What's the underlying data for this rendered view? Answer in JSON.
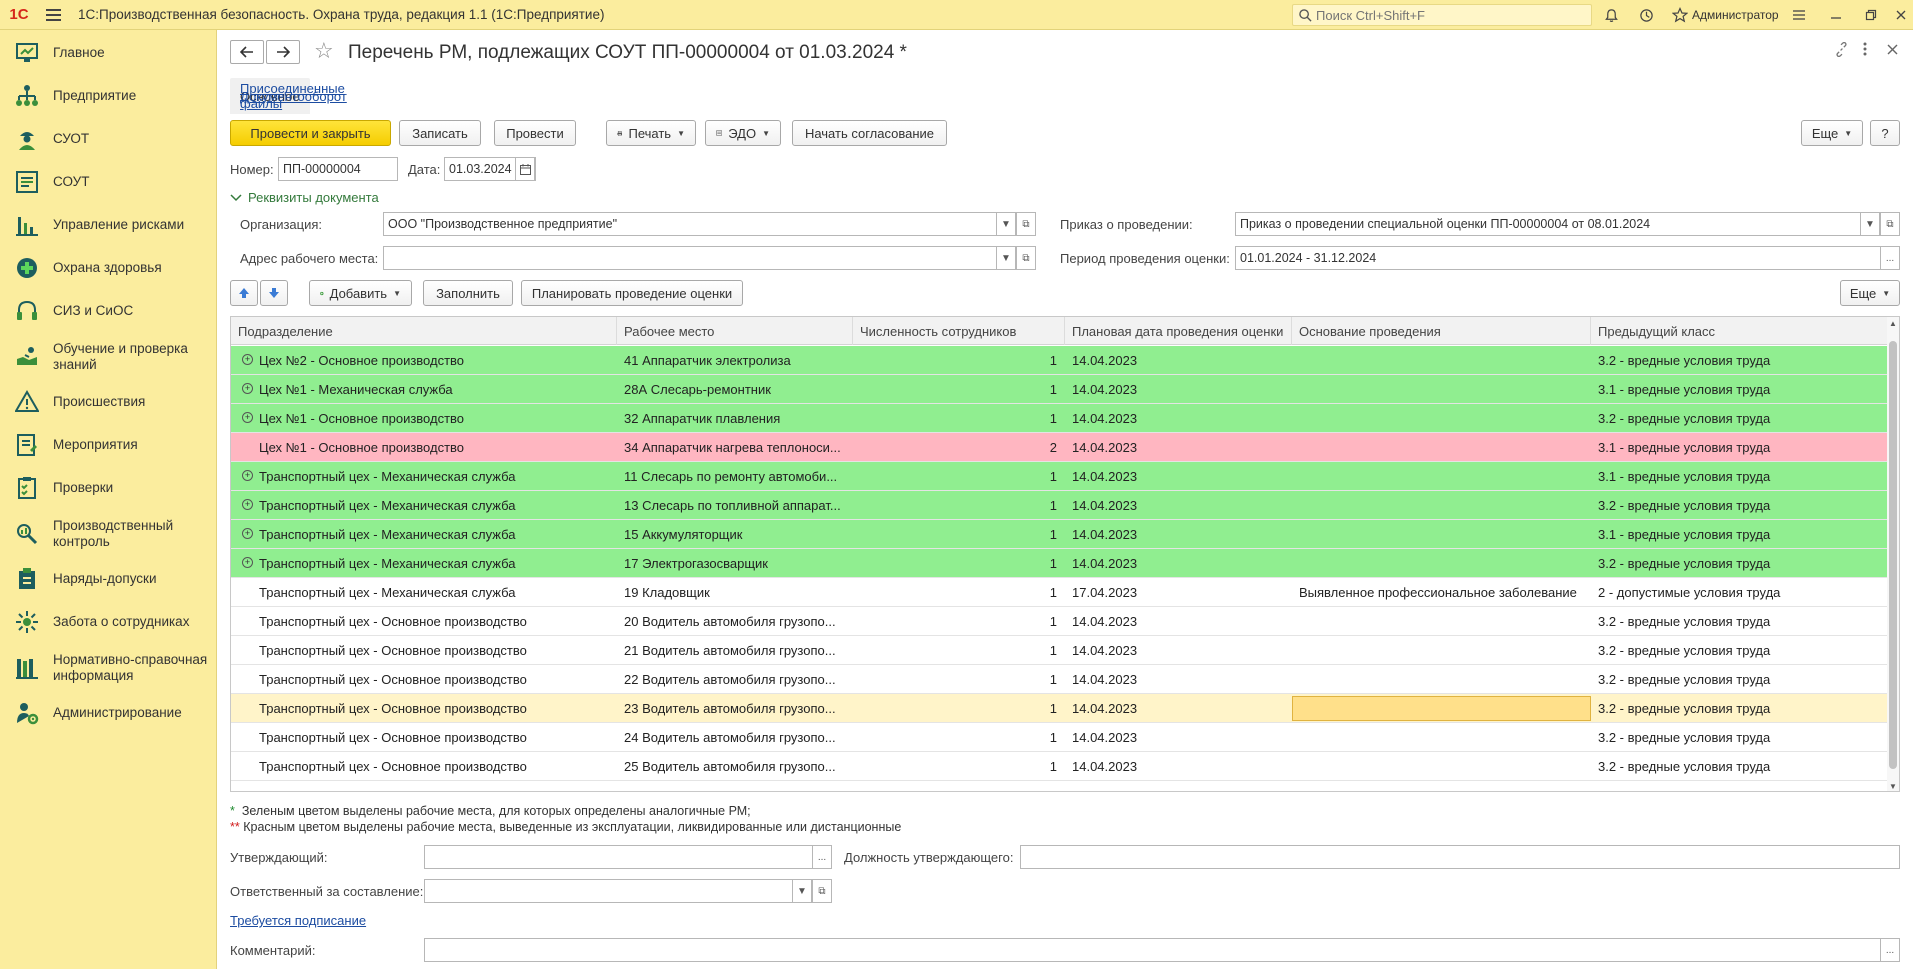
{
  "app": {
    "logo": "1С",
    "title": "1С:Производственная безопасность. Охрана труда, редакция 1.1  (1С:Предприятие)",
    "search_placeholder": "Поиск Ctrl+Shift+F",
    "user": "Администратор"
  },
  "sidebar": {
    "items": [
      {
        "label": "Главное",
        "icon": "desktop-icon"
      },
      {
        "label": "Предприятие",
        "icon": "org-structure-icon"
      },
      {
        "label": "СУОТ",
        "icon": "worker-icon"
      },
      {
        "label": "СОУТ",
        "icon": "list-icon"
      },
      {
        "label": "Управление рисками",
        "icon": "chart-icon"
      },
      {
        "label": "Охрана здоровья",
        "icon": "medical-cross-icon"
      },
      {
        "label": "СИЗ и СиОС",
        "icon": "headphones-icon"
      },
      {
        "label": "Обучение и проверка знаний",
        "icon": "training-icon"
      },
      {
        "label": "Происшествия",
        "icon": "warning-icon"
      },
      {
        "label": "Мероприятия",
        "icon": "tasks-icon"
      },
      {
        "label": "Проверки",
        "icon": "checklist-icon"
      },
      {
        "label": "Производственный контроль",
        "icon": "inspection-icon"
      },
      {
        "label": "Наряды-допуски",
        "icon": "permit-icon"
      },
      {
        "label": "Забота о сотрудниках",
        "icon": "care-icon"
      },
      {
        "label": "Нормативно-справочная информация",
        "icon": "reference-icon"
      },
      {
        "label": "Администрирование",
        "icon": "admin-icon"
      }
    ]
  },
  "document": {
    "title": "Перечень РМ, подлежащих СОУТ ПП-00000004 от 01.03.2024 *",
    "tabs": [
      "Основное",
      "Присоединенные файлы",
      "Документооборот"
    ],
    "toolbar": {
      "post_close": "Провести и закрыть",
      "save": "Записать",
      "post": "Провести",
      "print": "Печать",
      "edo": "ЭДО",
      "approval": "Начать согласование",
      "more": "Еще",
      "help": "?"
    },
    "number_label": "Номер:",
    "number_value": "ПП-00000004",
    "date_label": "Дата:",
    "date_value": "01.03.2024",
    "details_toggle": "Реквизиты документа",
    "org_label": "Организация:",
    "org_value": "ООО \"Производственное предприятие\"",
    "address_label": "Адрес рабочего места:",
    "address_value": "",
    "order_label": "Приказ о проведении:",
    "order_value": "Приказ о проведении специальной оценки ПП-00000004 от 08.01.2024",
    "period_label": "Период проведения оценки:",
    "period_value": "01.01.2024 - 31.12.2024"
  },
  "table_toolbar": {
    "add": "Добавить",
    "fill": "Заполнить",
    "plan": "Планировать проведение оценки",
    "more": "Еще"
  },
  "table": {
    "headers": [
      "Подразделение",
      "Рабочее место",
      "Численность сотрудников",
      "Плановая дата проведения оценки",
      "Основание проведения",
      "Предыдущий класс"
    ],
    "rows": [
      {
        "dept": "Цех №2 - Основное производство",
        "place": "41 Аппаратчик электролиза",
        "count": "1",
        "date": "14.04.2023",
        "basis": "",
        "cls": "3.2 - вредные условия труда",
        "status": "green",
        "expand": true
      },
      {
        "dept": "Цех №1 - Механическая служба",
        "place": "28А Слесарь-ремонтник",
        "count": "1",
        "date": "14.04.2023",
        "basis": "",
        "cls": "3.1 - вредные условия труда",
        "status": "green",
        "expand": true
      },
      {
        "dept": "Цех №1 - Основное производство",
        "place": "32 Аппаратчик плавления",
        "count": "1",
        "date": "14.04.2023",
        "basis": "",
        "cls": "3.2 - вредные условия труда",
        "status": "green",
        "expand": true
      },
      {
        "dept": "Цех №1 - Основное производство",
        "place": "34 Аппаратчик нагрева теплоноси...",
        "count": "2",
        "date": "14.04.2023",
        "basis": "",
        "cls": "3.1 - вредные условия труда",
        "status": "red",
        "expand": false
      },
      {
        "dept": "Транспортный цех - Механическая служба",
        "place": "11 Слесарь по ремонту автомоби...",
        "count": "1",
        "date": "14.04.2023",
        "basis": "",
        "cls": "3.1 - вредные условия труда",
        "status": "green",
        "expand": true
      },
      {
        "dept": "Транспортный цех - Механическая служба",
        "place": "13 Слесарь по топливной аппарат...",
        "count": "1",
        "date": "14.04.2023",
        "basis": "",
        "cls": "3.2 - вредные условия труда",
        "status": "green",
        "expand": true
      },
      {
        "dept": "Транспортный цех - Механическая служба",
        "place": "15 Аккумуляторщик",
        "count": "1",
        "date": "14.04.2023",
        "basis": "",
        "cls": "3.1 - вредные условия труда",
        "status": "green",
        "expand": true
      },
      {
        "dept": "Транспортный цех - Механическая служба",
        "place": "17 Электрогазосварщик",
        "count": "1",
        "date": "14.04.2023",
        "basis": "",
        "cls": "3.2 - вредные условия труда",
        "status": "green",
        "expand": true
      },
      {
        "dept": "Транспортный цех - Механическая служба",
        "place": "19 Кладовщик",
        "count": "1",
        "date": "17.04.2023",
        "basis": "Выявленное профессиональное заболевание",
        "cls": "2 - допустимые условия труда",
        "status": "white",
        "expand": false
      },
      {
        "dept": "Транспортный цех - Основное производство",
        "place": "20 Водитель автомобиля грузопо...",
        "count": "1",
        "date": "14.04.2023",
        "basis": "",
        "cls": "3.2 - вредные условия труда",
        "status": "white",
        "expand": false
      },
      {
        "dept": "Транспортный цех - Основное производство",
        "place": "21 Водитель автомобиля грузопо...",
        "count": "1",
        "date": "14.04.2023",
        "basis": "",
        "cls": "3.2 - вредные условия труда",
        "status": "white",
        "expand": false
      },
      {
        "dept": "Транспортный цех - Основное производство",
        "place": "22 Водитель автомобиля грузопо...",
        "count": "1",
        "date": "14.04.2023",
        "basis": "",
        "cls": "3.2 - вредные условия труда",
        "status": "white",
        "expand": false
      },
      {
        "dept": "Транспортный цех - Основное производство",
        "place": "23 Водитель автомобиля грузопо...",
        "count": "1",
        "date": "14.04.2023",
        "basis": "",
        "cls": "3.2 - вредные условия труда",
        "status": "selected",
        "expand": false
      },
      {
        "dept": "Транспортный цех - Основное производство",
        "place": "24 Водитель автомобиля грузопо...",
        "count": "1",
        "date": "14.04.2023",
        "basis": "",
        "cls": "3.2 - вредные условия труда",
        "status": "white",
        "expand": false
      },
      {
        "dept": "Транспортный цех - Основное производство",
        "place": "25 Водитель автомобиля грузопо...",
        "count": "1",
        "date": "14.04.2023",
        "basis": "",
        "cls": "3.2 - вредные условия труда",
        "status": "white",
        "expand": false
      }
    ]
  },
  "notes": {
    "green_mark": "*",
    "green_text": "Зеленым цветом выделены рабочие места, для которых определены аналогичные РМ;",
    "red_mark": "**",
    "red_text": "Красным цветом выделены рабочие места, выведенные из эксплуатации, ликвидированные или дистанционные"
  },
  "footer": {
    "approver_label": "Утверждающий:",
    "approver_value": "",
    "approver_position_label": "Должность утверждающего:",
    "approver_position_value": "",
    "responsible_label": "Ответственный за составление:",
    "responsible_value": "",
    "signature_link": "Требуется подписание",
    "comment_label": "Комментарий:",
    "comment_value": ""
  },
  "colors": {
    "green_row": "#90ee90",
    "red_row": "#ffb6c1",
    "selected_row": "#fff4c9",
    "selected_cell": "#ffe08a",
    "accent": "#f5cd00",
    "sidebar_bg": "#fbed9e"
  }
}
